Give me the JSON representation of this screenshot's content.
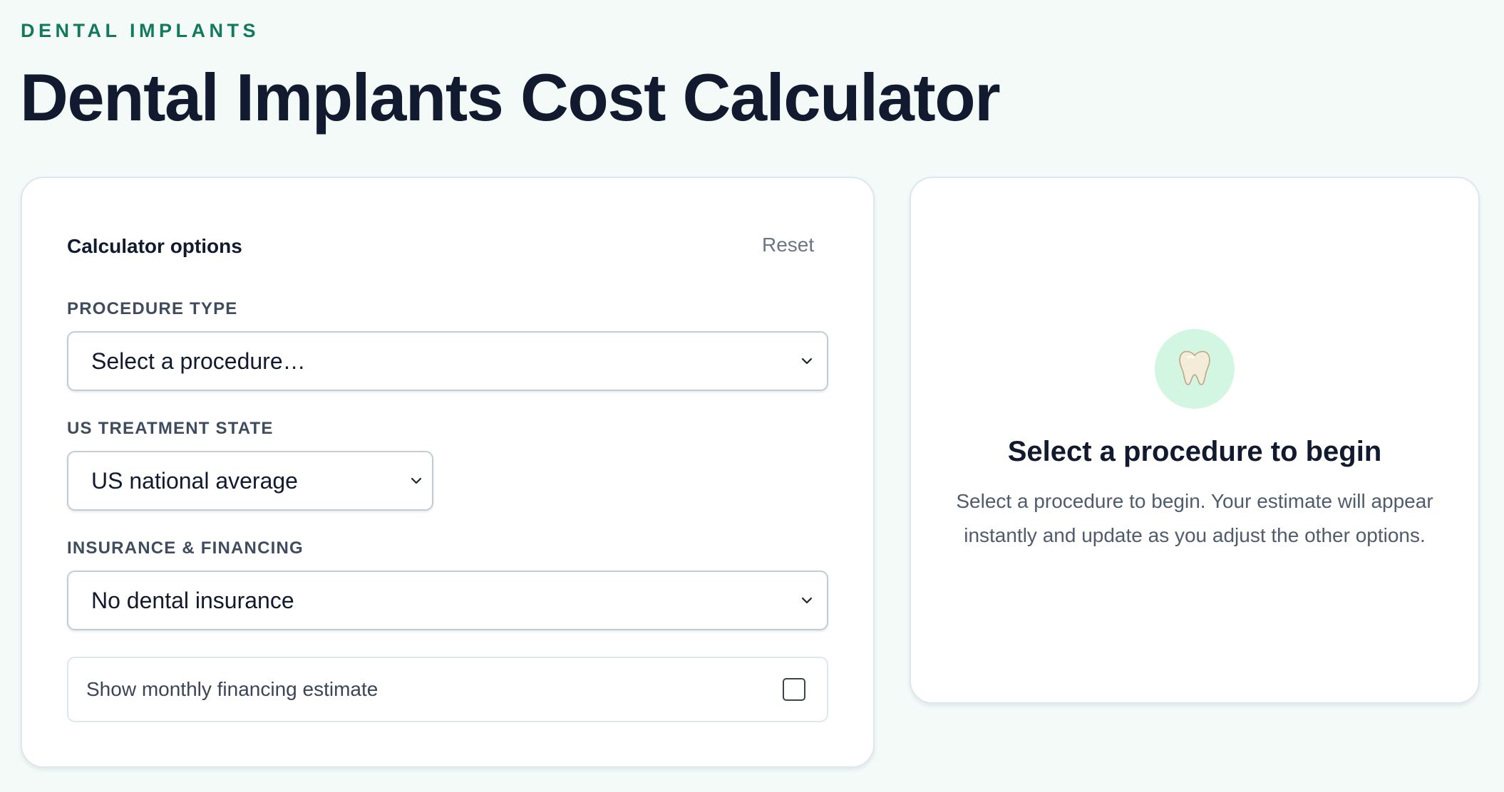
{
  "header": {
    "eyebrow": "DENTAL IMPLANTS",
    "title": "Dental Implants Cost Calculator"
  },
  "options": {
    "title": "Calculator options",
    "reset_label": "Reset",
    "procedure": {
      "label": "PROCEDURE TYPE",
      "value": "Select a procedure…"
    },
    "state": {
      "label": "US TREATMENT STATE",
      "value": "US national average"
    },
    "insurance": {
      "label": "INSURANCE & FINANCING",
      "value": "No dental insurance"
    },
    "financing": {
      "label": "Show monthly financing estimate",
      "checked": false
    }
  },
  "result": {
    "icon": "tooth-icon",
    "title": "Select a procedure to begin",
    "message": "Select a procedure to begin. Your estimate will appear instantly and update as you adjust the other options."
  },
  "colors": {
    "accent": "#127a5b",
    "page_background": "#f3faf8",
    "icon_circle": "#d3f6e2",
    "heading": "#111a2e"
  }
}
